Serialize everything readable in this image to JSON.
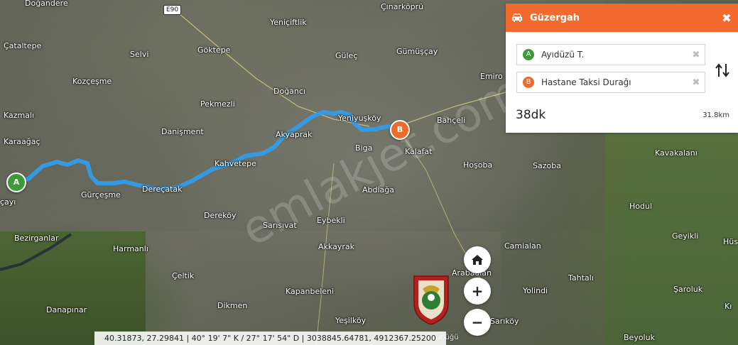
{
  "map": {
    "road_label": "E90",
    "watermark": "emlakjet.com",
    "attribution_partial": "Müdürlüğü",
    "places": [
      {
        "name": "Doğandere"
      },
      {
        "name": "Çınarköprü"
      },
      {
        "name": "Yeniçiftlik"
      },
      {
        "name": "Çataltepe"
      },
      {
        "name": "Göktepe"
      },
      {
        "name": "Güleç"
      },
      {
        "name": "Gümüşçay"
      },
      {
        "name": "Selvi"
      },
      {
        "name": "Emiro"
      },
      {
        "name": "Kozçeşme"
      },
      {
        "name": "Doğancı"
      },
      {
        "name": "Pekmezli"
      },
      {
        "name": "Kazmalı"
      },
      {
        "name": "Yeniyuşköy"
      },
      {
        "name": "Bahçeli"
      },
      {
        "name": "Danişment"
      },
      {
        "name": "Akyaprak"
      },
      {
        "name": "Karaağaç"
      },
      {
        "name": "Biga"
      },
      {
        "name": "Kalafat"
      },
      {
        "name": "Kavakalanı"
      },
      {
        "name": "Kahvetepe"
      },
      {
        "name": "Hoşoba"
      },
      {
        "name": "Sazoba"
      },
      {
        "name": "Gürçeşme"
      },
      {
        "name": "Dereçatak"
      },
      {
        "name": "Abdiağa"
      },
      {
        "name": "Hodul"
      },
      {
        "name": "çayı"
      },
      {
        "name": "Dereköy"
      },
      {
        "name": "Eybekli"
      },
      {
        "name": "Sarısıvat"
      },
      {
        "name": "Bezirganlar"
      },
      {
        "name": "Geyikli"
      },
      {
        "name": "Hüs"
      },
      {
        "name": "Harmanlı"
      },
      {
        "name": "Camialan"
      },
      {
        "name": "Akkayrak"
      },
      {
        "name": "Çeltik"
      },
      {
        "name": "Arabaalan"
      },
      {
        "name": "Tahtalı"
      },
      {
        "name": "Kapanbeleni"
      },
      {
        "name": "Yolindi"
      },
      {
        "name": "Şaroluk"
      },
      {
        "name": "Danapınar"
      },
      {
        "name": "Dikmen"
      },
      {
        "name": "Kı"
      },
      {
        "name": "Yeşilköy"
      },
      {
        "name": "Sarıköy"
      },
      {
        "name": "Beyoluk"
      }
    ],
    "markers": {
      "a": "A",
      "b": "B"
    }
  },
  "route_panel": {
    "title": "Güzergah",
    "close": "✖",
    "origin": {
      "badge": "A",
      "label": "Ayıdüzü T.",
      "clear": "✖"
    },
    "destination": {
      "badge": "B",
      "label": "Hastane Taksi Durağı",
      "clear": "✖"
    },
    "duration": "38dk",
    "distance": "31.8km"
  },
  "controls": {
    "home_icon": "home-icon",
    "zoom_in": "+",
    "zoom_out": "−"
  },
  "coordinates": "40.31873, 27.29841 | 40° 19' 7\" K / 27° 17' 54\" D | 3038845.64781, 4912367.25200",
  "colors": {
    "route": "#2f9ff0",
    "panel_header": "#f26a2e",
    "marker_a": "#3c9a3a",
    "marker_b": "#ec6a2c"
  }
}
